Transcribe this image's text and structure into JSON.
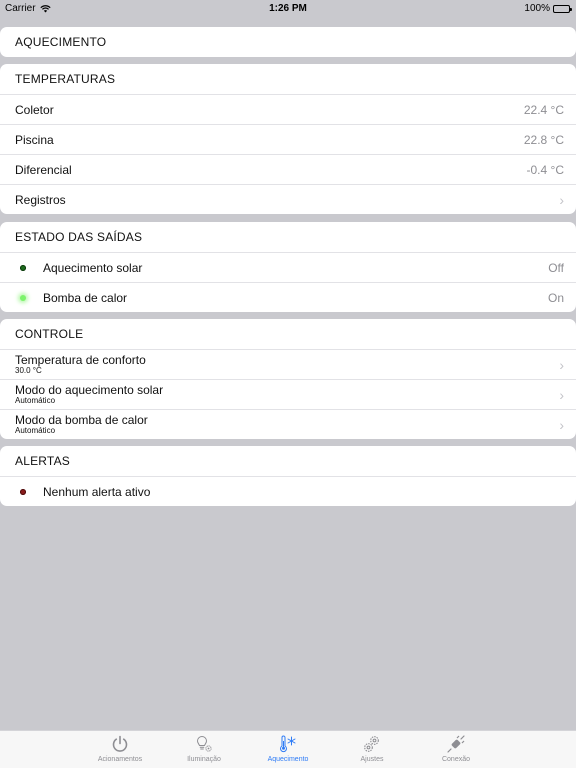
{
  "status": {
    "carrier": "Carrier",
    "time": "1:26 PM",
    "battery": "100%"
  },
  "aquecimento": {
    "title": "AQUECIMENTO"
  },
  "temperaturas": {
    "header": "TEMPERATURAS",
    "rows": [
      {
        "label": "Coletor",
        "value": "22.4 °C"
      },
      {
        "label": "Piscina",
        "value": "22.8 °C"
      },
      {
        "label": "Diferencial",
        "value": "-0.4 °C"
      }
    ],
    "registros": "Registros"
  },
  "saidas": {
    "header": "ESTADO DAS SAÍDAS",
    "rows": [
      {
        "label": "Aquecimento solar",
        "value": "Off"
      },
      {
        "label": "Bomba de calor",
        "value": "On"
      }
    ]
  },
  "controle": {
    "header": "CONTROLE",
    "rows": [
      {
        "label": "Temperatura de conforto",
        "sub": "30.0 °C"
      },
      {
        "label": "Modo do aquecimento solar",
        "sub": "Automático"
      },
      {
        "label": "Modo da bomba de calor",
        "sub": "Automático"
      }
    ]
  },
  "alertas": {
    "header": "ALERTAS",
    "message": "Nenhum alerta ativo"
  },
  "tabs": [
    {
      "label": "Acionamentos",
      "icon": "power-icon"
    },
    {
      "label": "Iluminação",
      "icon": "bulb-gear-icon"
    },
    {
      "label": "Aquecimento",
      "icon": "thermometer-snow-icon"
    },
    {
      "label": "Ajustes",
      "icon": "gears-icon"
    },
    {
      "label": "Conexão",
      "icon": "plug-icon"
    }
  ],
  "colors": {
    "accent": "#2f7cf6",
    "background": "#c9c9ce",
    "led_on": "#7cf36b",
    "led_off": "#1e6b1e",
    "led_alert": "#8a1b1b"
  }
}
